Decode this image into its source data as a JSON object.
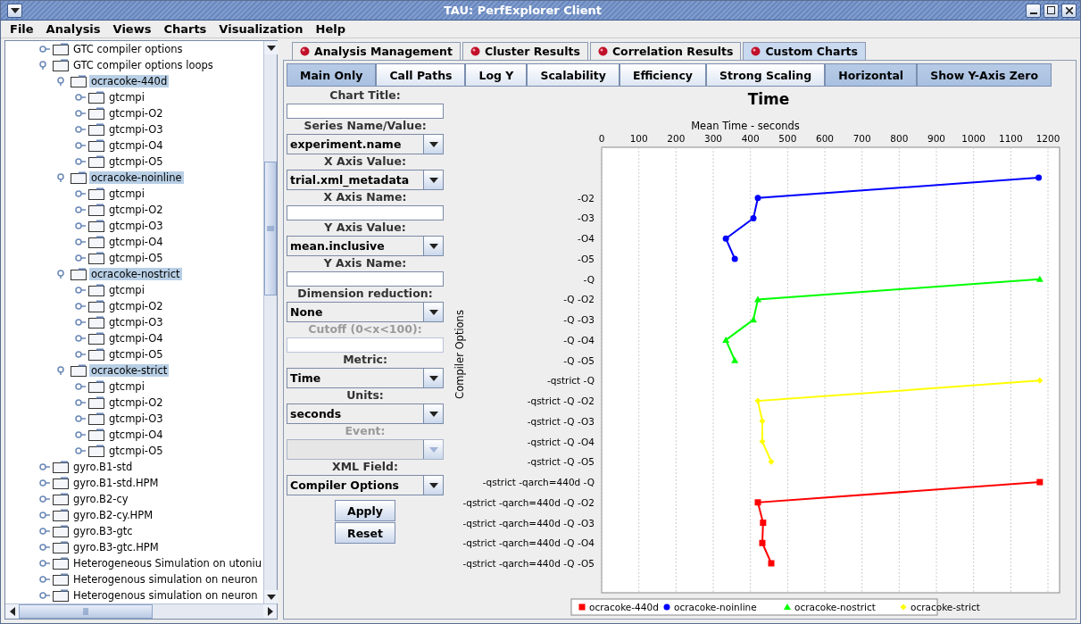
{
  "window": {
    "title": "TAU: PerfExplorer Client"
  },
  "menu": [
    "File",
    "Analysis",
    "Views",
    "Charts",
    "Visualization",
    "Help"
  ],
  "tree": [
    {
      "label": "GTC compiler options",
      "selected": false,
      "expanded": false
    },
    {
      "label": "GTC compiler options loops",
      "selected": false,
      "expanded": true,
      "children": [
        {
          "label": "ocracoke-440d",
          "selected": true,
          "expanded": true,
          "children": [
            {
              "label": "gtcmpi",
              "selected": false,
              "expanded": false
            },
            {
              "label": "gtcmpi-O2",
              "selected": false,
              "expanded": false
            },
            {
              "label": "gtcmpi-O3",
              "selected": false,
              "expanded": false
            },
            {
              "label": "gtcmpi-O4",
              "selected": false,
              "expanded": false
            },
            {
              "label": "gtcmpi-O5",
              "selected": false,
              "expanded": false
            }
          ]
        },
        {
          "label": "ocracoke-noinline",
          "selected": true,
          "expanded": true,
          "children": [
            {
              "label": "gtcmpi",
              "selected": false,
              "expanded": false
            },
            {
              "label": "gtcmpi-O2",
              "selected": false,
              "expanded": false
            },
            {
              "label": "gtcmpi-O3",
              "selected": false,
              "expanded": false
            },
            {
              "label": "gtcmpi-O4",
              "selected": false,
              "expanded": false
            },
            {
              "label": "gtcmpi-O5",
              "selected": false,
              "expanded": false
            }
          ]
        },
        {
          "label": "ocracoke-nostrict",
          "selected": true,
          "expanded": true,
          "children": [
            {
              "label": "gtcmpi",
              "selected": false,
              "expanded": false
            },
            {
              "label": "gtcmpi-O2",
              "selected": false,
              "expanded": false
            },
            {
              "label": "gtcmpi-O3",
              "selected": false,
              "expanded": false
            },
            {
              "label": "gtcmpi-O4",
              "selected": false,
              "expanded": false
            },
            {
              "label": "gtcmpi-O5",
              "selected": false,
              "expanded": false
            }
          ]
        },
        {
          "label": "ocracoke-strict",
          "selected": true,
          "expanded": true,
          "children": [
            {
              "label": "gtcmpi",
              "selected": false,
              "expanded": false
            },
            {
              "label": "gtcmpi-O2",
              "selected": false,
              "expanded": false
            },
            {
              "label": "gtcmpi-O3",
              "selected": false,
              "expanded": false
            },
            {
              "label": "gtcmpi-O4",
              "selected": false,
              "expanded": false
            },
            {
              "label": "gtcmpi-O5",
              "selected": false,
              "expanded": false
            }
          ]
        }
      ]
    },
    {
      "label": "gyro.B1-std",
      "selected": false,
      "expanded": false
    },
    {
      "label": "gyro.B1-std.HPM",
      "selected": false,
      "expanded": false
    },
    {
      "label": "gyro.B2-cy",
      "selected": false,
      "expanded": false
    },
    {
      "label": "gyro.B2-cy.HPM",
      "selected": false,
      "expanded": false
    },
    {
      "label": "gyro.B3-gtc",
      "selected": false,
      "expanded": false
    },
    {
      "label": "gyro.B3-gtc.HPM",
      "selected": false,
      "expanded": false
    },
    {
      "label": "Heterogeneous Simulation on utoniu",
      "selected": false,
      "expanded": false
    },
    {
      "label": "Heterogenous simulation on neuron",
      "selected": false,
      "expanded": false
    },
    {
      "label": "Heterogenous simulation on neuron",
      "selected": false,
      "expanded": false
    }
  ],
  "tabs": [
    {
      "label": "Analysis Management",
      "selected": false
    },
    {
      "label": "Cluster Results",
      "selected": false
    },
    {
      "label": "Correlation Results",
      "selected": false
    },
    {
      "label": "Custom Charts",
      "selected": true
    }
  ],
  "toolbar": [
    {
      "label": "Main Only",
      "on": true
    },
    {
      "label": "Call Paths",
      "on": false
    },
    {
      "label": "Log Y",
      "on": false
    },
    {
      "label": "Scalability",
      "on": false
    },
    {
      "label": "Efficiency",
      "on": false
    },
    {
      "label": "Strong Scaling",
      "on": false
    },
    {
      "label": "Horizontal",
      "on": true
    },
    {
      "label": "Show Y-Axis Zero",
      "on": true
    }
  ],
  "form": [
    {
      "label": "Chart Title:",
      "kind": "text",
      "disabled": false
    },
    {
      "label": "Series Name/Value:",
      "kind": "combo",
      "value": "experiment.name",
      "disabled": false
    },
    {
      "label": "X Axis Value:",
      "kind": "combo",
      "value": "trial.xml_metadata",
      "disabled": false
    },
    {
      "label": "X Axis Name:",
      "kind": "text",
      "disabled": false
    },
    {
      "label": "Y Axis Value:",
      "kind": "combo",
      "value": "mean.inclusive",
      "disabled": false
    },
    {
      "label": "Y Axis Name:",
      "kind": "text",
      "disabled": false
    },
    {
      "label": "Dimension reduction:",
      "kind": "combo",
      "value": "None",
      "disabled": false
    },
    {
      "label": "Cutoff (0<x<100):",
      "kind": "text",
      "disabled": true
    },
    {
      "label": "Metric:",
      "kind": "combo",
      "value": "Time",
      "disabled": false
    },
    {
      "label": "Units:",
      "kind": "combo",
      "value": "seconds",
      "disabled": false
    },
    {
      "label": "Event:",
      "kind": "combo",
      "disabled": true
    },
    {
      "label": "XML Field:",
      "kind": "combo",
      "value": "Compiler Options",
      "disabled": false
    }
  ],
  "buttons": [
    "Apply",
    "Reset"
  ],
  "chart_data": {
    "type": "line",
    "orientation": "horizontal",
    "title": "Time",
    "xlabel": "Mean Time - seconds",
    "ylabel": "Compiler Options",
    "legend": "bottom",
    "grid": true,
    "categories": [
      null,
      "-O2",
      "-O3",
      "-O4",
      "-O5",
      "-Q",
      "-Q -O2",
      "-Q -O3",
      "-Q -O4",
      "-Q -O5",
      "-qstrict -Q",
      "-qstrict -Q -O2",
      "-qstrict -Q -O3",
      "-qstrict -Q -O4",
      "-qstrict -Q -O5",
      "-qstrict -qarch=440d -Q",
      "-qstrict -qarch=440d -Q -O2",
      "-qstrict -qarch=440d -Q -O3",
      "-qstrict -qarch=440d -Q -O4",
      "-qstrict -qarch=440d -Q -O5"
    ],
    "xlim": [
      0,
      1200
    ],
    "xticks": [
      0,
      100,
      200,
      300,
      400,
      500,
      600,
      700,
      800,
      900,
      1000,
      1100,
      1200
    ],
    "series": [
      {
        "name": "ocracoke-440d",
        "color": "#ff0000",
        "marker": "square",
        "values": [
          null,
          null,
          null,
          null,
          null,
          null,
          null,
          null,
          null,
          null,
          null,
          null,
          null,
          null,
          null,
          1178,
          420,
          434,
          432,
          456
        ]
      },
      {
        "name": "ocracoke-noinline",
        "color": "#0000ff",
        "marker": "circle",
        "values": [
          1175,
          420,
          408,
          334,
          358,
          null,
          null,
          null,
          null,
          null,
          null,
          null,
          null,
          null,
          null,
          null,
          null,
          null,
          null,
          null
        ]
      },
      {
        "name": "ocracoke-nostrict",
        "color": "#00ff00",
        "marker": "triangle",
        "values": [
          null,
          null,
          null,
          null,
          null,
          1178,
          420,
          408,
          334,
          358,
          null,
          null,
          null,
          null,
          null,
          null,
          null,
          null,
          null,
          null
        ]
      },
      {
        "name": "ocracoke-strict",
        "color": "#ffff00",
        "marker": "diamond",
        "values": [
          null,
          null,
          null,
          null,
          null,
          null,
          null,
          null,
          null,
          null,
          1178,
          420,
          432,
          432,
          456,
          null,
          null,
          null,
          null,
          null
        ]
      }
    ]
  }
}
